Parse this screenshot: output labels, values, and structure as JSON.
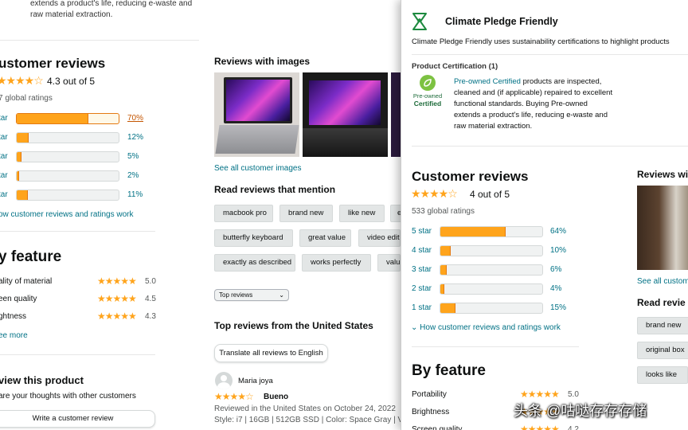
{
  "left": {
    "top_desc_line1": "extends a product's life, reducing e-waste and",
    "top_desc_line2": "raw material extraction.",
    "reviews_title": "ustomer reviews",
    "rating_stars": "★★★★☆",
    "rating_text": "4.3 out of 5",
    "global_ratings": "7 global ratings",
    "bars": [
      {
        "label": "tar",
        "pct": 70,
        "pct_label": "70%"
      },
      {
        "label": "tar",
        "pct": 12,
        "pct_label": "12%"
      },
      {
        "label": "tar",
        "pct": 5,
        "pct_label": "5%"
      },
      {
        "label": "tar",
        "pct": 2,
        "pct_label": "2%"
      },
      {
        "label": "tar",
        "pct": 11,
        "pct_label": "11%"
      }
    ],
    "how_link": "ow customer reviews and ratings work",
    "by_feature_title": "y feature",
    "features": [
      {
        "name": "ality of material",
        "stars": "★★★★★",
        "value": "5.0"
      },
      {
        "name": "een quality",
        "stars": "★★★★★",
        "value": "4.5"
      },
      {
        "name": "ghtness",
        "stars": "★★★★★",
        "value": "4.3"
      }
    ],
    "see_more": "ee more",
    "review_product_title": "view this product",
    "share_text": "are your thoughts with other customers",
    "write_review": "Write a customer review"
  },
  "middle": {
    "reviews_images_title": "Reviews with images",
    "see_all_images": "See all customer images",
    "mention_title": "Read reviews that mention",
    "chips_row1": [
      "macbook pro",
      "brand new",
      "like new",
      "e"
    ],
    "chips_row2": [
      "butterfly keyboard",
      "great value",
      "video edit"
    ],
    "chips_row3": [
      "exactly as described",
      "works perfectly",
      "value"
    ],
    "sort_label": "Top reviews",
    "top_reviews_title": "Top reviews from the United States",
    "translate_btn": "Translate all reviews to English",
    "reviewer_name": "Maria joya",
    "review_stars": "★★★★☆",
    "review_title": "Bueno",
    "review_meta": "Reviewed in the United States on October 24, 2022",
    "review_style": "Style: i7 | 16GB | 512GB SSD  |  Color: Space Gray  |  V"
  },
  "overlay": {
    "cpf_title": "Climate Pledge Friendly",
    "cpf_desc": "Climate Pledge Friendly uses sustainability certifications to highlight products",
    "cert_heading": "Product Certification (1)",
    "cert_badge_line1": "Pre-owned",
    "cert_badge_line2": "Certified",
    "cert_link": "Pre-owned Certified",
    "cert_desc_1": " products are inspected,",
    "cert_desc_2": "cleaned and (if applicable) repaired to excellent",
    "cert_desc_3": "functional standards. Buying Pre-owned",
    "cert_desc_4": "extends a product's life, reducing e-waste and",
    "cert_desc_5": "raw material extraction.",
    "reviews_title": "Customer reviews",
    "rating_stars": "★★★★☆",
    "rating_text": "4 out of 5",
    "global_ratings": "533 global ratings",
    "bars": [
      {
        "label": "5 star",
        "pct": 64,
        "pct_label": "64%"
      },
      {
        "label": "4 star",
        "pct": 10,
        "pct_label": "10%"
      },
      {
        "label": "3 star",
        "pct": 6,
        "pct_label": "6%"
      },
      {
        "label": "2 star",
        "pct": 4,
        "pct_label": "4%"
      },
      {
        "label": "1 star",
        "pct": 15,
        "pct_label": "15%"
      }
    ],
    "how_link": "How customer reviews and ratings work",
    "by_feature_title": "By feature",
    "features": [
      {
        "name": "Portability",
        "stars": "★★★★★",
        "value": "5.0"
      },
      {
        "name": "Brightness",
        "stars": "★★★★★",
        "value": ""
      },
      {
        "name": "Screen quality",
        "stars": "★★★★★",
        "value": "4.2"
      }
    ],
    "reviews_with_images": "Reviews wi",
    "see_all": "See all custom",
    "read_reviews": "Read revie",
    "chips": [
      "brand new",
      "original box",
      "looks like"
    ]
  },
  "watermark": "头条 @咕哒存存存储",
  "colors": {
    "star": "#ffa41c",
    "link": "#007185",
    "cpf_green": "#1d8a3f"
  }
}
